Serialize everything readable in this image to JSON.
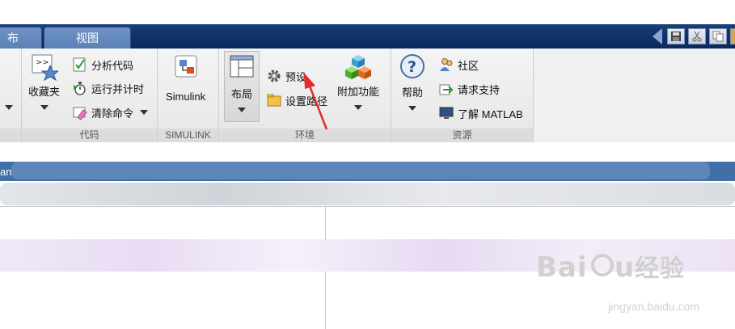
{
  "tabs": [
    {
      "label": "布"
    },
    {
      "label": "视图"
    }
  ],
  "quick_access": [
    "save-icon",
    "cut-icon",
    "copy-icon"
  ],
  "groups": {
    "code": {
      "label": "代码",
      "favorites": "收藏夹",
      "analyze": "分析代码",
      "run_and_time": "运行并计时",
      "clear_commands": "清除命令"
    },
    "simulink": {
      "label": "SIMULINK",
      "button": "Simulink"
    },
    "environment": {
      "label": "环境",
      "layout": "布局",
      "preferences": "预设",
      "set_path": "设置路径",
      "addons": "附加功能"
    },
    "resources": {
      "label": "资源",
      "help": "帮助",
      "community": "社区",
      "request_support": "请求支持",
      "learn_matlab": "了解 MATLAB"
    }
  },
  "pathbar": {
    "text": "an"
  },
  "watermark": {
    "brand": "Bai du 经验",
    "url": "jingyan.baidu.com"
  },
  "colors": {
    "tab_bar": "#0f2f66",
    "tab": "#5b80b6",
    "annotation": "#e32b2b",
    "pathbar": "#416fa8"
  }
}
